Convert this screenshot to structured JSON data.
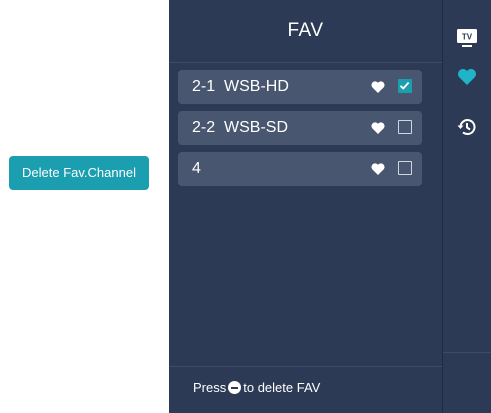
{
  "callout": {
    "label": "Delete Fav.Channel"
  },
  "panel": {
    "title": "FAV",
    "channels": [
      {
        "number": "2-1",
        "name": "WSB-HD",
        "favorite": true,
        "checked": true
      },
      {
        "number": "2-2",
        "name": "WSB-SD",
        "favorite": true,
        "checked": false
      },
      {
        "number": "4",
        "name": "",
        "favorite": true,
        "checked": false
      }
    ],
    "footer": {
      "prefix": "Press",
      "suffix": "to delete FAV",
      "key_icon": "menu-key-icon"
    }
  },
  "sidebar": {
    "items": [
      {
        "icon": "tv-icon",
        "label": "TV"
      },
      {
        "icon": "heart-icon"
      },
      {
        "icon": "history-icon"
      }
    ]
  },
  "colors": {
    "accent": "#1a9eb0",
    "panel_bg": "#2c3a55",
    "item_bg": "#48566f"
  }
}
